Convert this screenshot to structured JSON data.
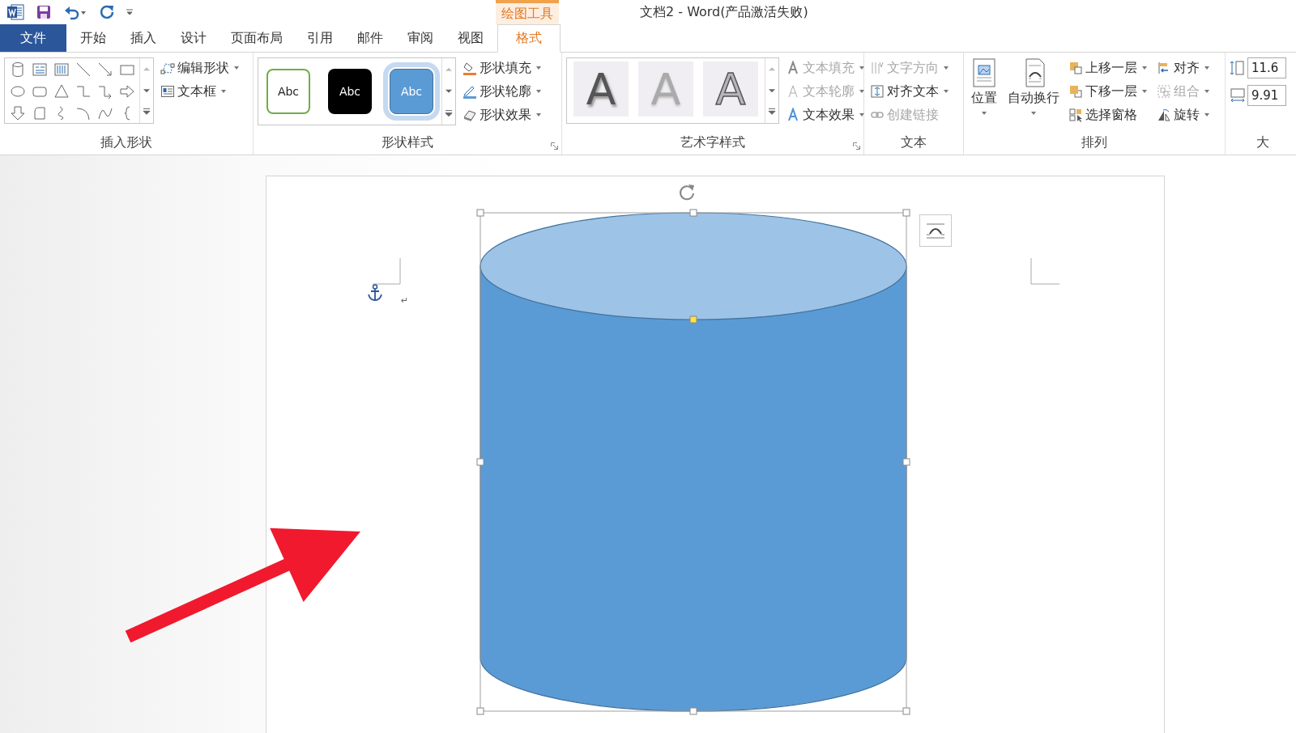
{
  "window": {
    "title": "文档2 - Word(产品激活失败)",
    "context_tab": "绘图工具"
  },
  "tabs": [
    {
      "label": "文件",
      "kind": "file",
      "selected": false
    },
    {
      "label": "开始",
      "kind": "normal",
      "selected": false
    },
    {
      "label": "插入",
      "kind": "normal",
      "selected": false
    },
    {
      "label": "设计",
      "kind": "normal",
      "selected": false
    },
    {
      "label": "页面布局",
      "kind": "normal",
      "selected": false
    },
    {
      "label": "引用",
      "kind": "normal",
      "selected": false
    },
    {
      "label": "邮件",
      "kind": "normal",
      "selected": false
    },
    {
      "label": "审阅",
      "kind": "normal",
      "selected": false
    },
    {
      "label": "视图",
      "kind": "normal",
      "selected": false
    },
    {
      "label": "格式",
      "kind": "context",
      "selected": true
    }
  ],
  "ribbon": {
    "groups": [
      {
        "kind": "insert_shapes",
        "label": "插入形状",
        "commands": [
          {
            "label": "编辑形状",
            "disabled": false,
            "dropdown": true
          },
          {
            "label": "文本框",
            "disabled": false,
            "dropdown": true
          }
        ]
      },
      {
        "kind": "shape_styles",
        "label": "形状样式",
        "presets": [
          {
            "label": "Abc",
            "selected": false
          },
          {
            "label": "Abc",
            "selected": false
          },
          {
            "label": "Abc",
            "selected": true
          }
        ],
        "commands": [
          {
            "label": "形状填充",
            "disabled": false,
            "dropdown": true
          },
          {
            "label": "形状轮廓",
            "disabled": false,
            "dropdown": true
          },
          {
            "label": "形状效果",
            "disabled": false,
            "dropdown": true
          }
        ]
      },
      {
        "kind": "wordart",
        "label": "艺术字样式",
        "presets": [
          {
            "label": "A"
          },
          {
            "label": "A"
          },
          {
            "label": "A"
          }
        ],
        "commands": [
          {
            "label": "文本填充",
            "disabled": true,
            "dropdown": true
          },
          {
            "label": "文本轮廓",
            "disabled": true,
            "dropdown": true
          },
          {
            "label": "文本效果",
            "disabled": false,
            "dropdown": true
          }
        ]
      },
      {
        "kind": "text",
        "label": "文本",
        "commands": [
          {
            "label": "文字方向",
            "disabled": true,
            "dropdown": true
          },
          {
            "label": "对齐文本",
            "disabled": false,
            "dropdown": true
          },
          {
            "label": "创建链接",
            "disabled": true,
            "dropdown": false
          }
        ]
      },
      {
        "kind": "arrange",
        "label": "排列",
        "large": [
          {
            "label": "位置",
            "dropdown": true
          },
          {
            "label": "自动换行",
            "dropdown": true
          }
        ],
        "commands": [
          {
            "label": "上移一层",
            "disabled": false,
            "dropdown": true
          },
          {
            "label": "下移一层",
            "disabled": false,
            "dropdown": true
          },
          {
            "label": "选择窗格",
            "disabled": false,
            "dropdown": false
          },
          {
            "label": "对齐",
            "disabled": false,
            "dropdown": true
          },
          {
            "label": "组合",
            "disabled": true,
            "dropdown": true
          },
          {
            "label": "旋转",
            "disabled": false,
            "dropdown": true
          }
        ]
      },
      {
        "kind": "size",
        "label": "大",
        "fields": [
          {
            "value": "11.6"
          },
          {
            "value": "9.91"
          }
        ]
      }
    ]
  },
  "document": {
    "paragraph_mark": "↵"
  }
}
